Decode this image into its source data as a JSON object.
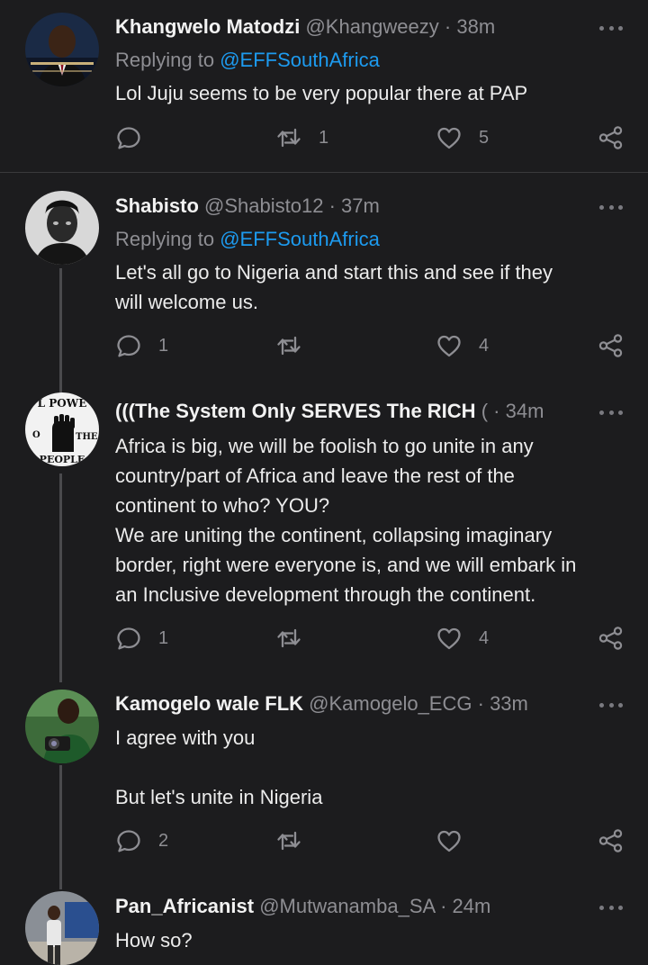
{
  "tweets": [
    {
      "name": "Khangwelo Matodzi",
      "handle": "@Khangweezy",
      "time": "38m",
      "replying_label": "Replying to",
      "replying_to": "@EFFSouthAfrica",
      "text": "Lol Juju seems to be very popular there at PAP",
      "replies": "",
      "retweets": "1",
      "likes": "5"
    },
    {
      "name": "Shabisto",
      "handle": "@Shabisto12",
      "time": "37m",
      "replying_label": "Replying to",
      "replying_to": "@EFFSouthAfrica",
      "text": "Let's all go to Nigeria and start this and see if they\nwill welcome us.",
      "replies": "1",
      "retweets": "",
      "likes": "4"
    },
    {
      "name": "(((The System Only SERVES The RICH",
      "handle": "(",
      "time": "34m",
      "text": "Africa is big, we will be foolish to go unite in any\ncountry/part of Africa and leave the rest of the\ncontinent to who? YOU?\nWe are uniting the continent, collapsing imaginary\nborder, right were everyone is, and we will embark in\nan Inclusive development through the continent.",
      "replies": "1",
      "retweets": "",
      "likes": "4",
      "avatar_text_top": "L POWE",
      "avatar_text_left": "O",
      "avatar_text_right": "THE",
      "avatar_text_bottom": "PEOPLE"
    },
    {
      "name": "Kamogelo wale FLK",
      "handle": "@Kamogelo_ECG",
      "time": "33m",
      "text": "I agree with you\n\nBut let's unite in Nigeria",
      "replies": "2",
      "retweets": "",
      "likes": ""
    },
    {
      "name": "Pan_Africanist",
      "handle": "@Mutwanamba_SA",
      "time": "24m",
      "text": "How so?"
    }
  ],
  "icons": [
    "reply-icon",
    "retweet-icon",
    "like-icon",
    "share-icon",
    "more-icon"
  ]
}
